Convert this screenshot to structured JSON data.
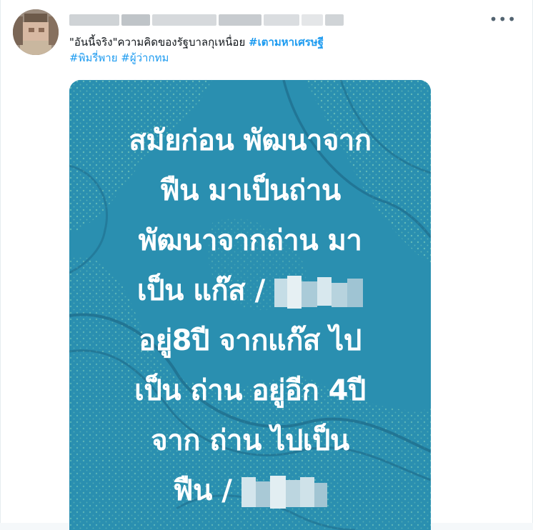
{
  "tweet": {
    "text_prefix": "\"อันนี้จริง\"ความคิดของรัฐบาลกุเหนื่อย ",
    "hashtags": [
      "#เตามหาเศรษฐี",
      "#พิมรี่พาย",
      "#ผู้ว่ากทม"
    ],
    "more_icon": "more-horizontal-icon"
  },
  "image": {
    "background_color": "#2a8fb0",
    "text_color": "#ffffff",
    "lines": [
      "สมัยก่อน พัฒนาจาก",
      "ฟืน มาเป็นถ่าน",
      "พัฒนาจากถ่าน มา",
      "เป็น แก๊ส /",
      "อยู่8ปี จากแก๊ส ไป",
      "เป็น ถ่าน อยู่อีก 4ปี",
      "จาก ถ่าน ไปเป็น",
      "ฟืน /"
    ]
  }
}
